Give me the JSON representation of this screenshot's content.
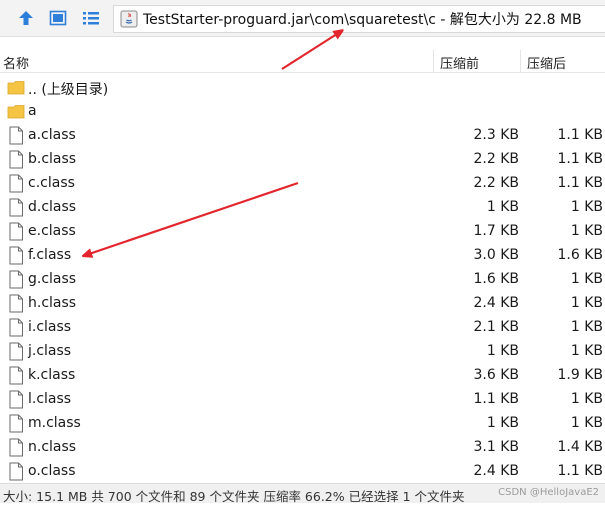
{
  "toolbar": {
    "icons": [
      "up-arrow-icon",
      "view-mode-icon",
      "list-mode-icon"
    ],
    "address": "TestStarter-proguard.jar\\com\\squaretest\\c - 解包大小为 22.8 MB"
  },
  "columns": {
    "name": "名称",
    "size": "压缩前",
    "packed": "压缩后"
  },
  "folders": [
    {
      "name": ".. (上级目录)"
    },
    {
      "name": "a"
    }
  ],
  "files": [
    {
      "name": "a.class",
      "size": "2.3 KB",
      "packed": "1.1 KB"
    },
    {
      "name": "b.class",
      "size": "2.2 KB",
      "packed": "1.1 KB"
    },
    {
      "name": "c.class",
      "size": "2.2 KB",
      "packed": "1.1 KB"
    },
    {
      "name": "d.class",
      "size": "1 KB",
      "packed": "1 KB"
    },
    {
      "name": "e.class",
      "size": "1.7 KB",
      "packed": "1 KB"
    },
    {
      "name": "f.class",
      "size": "3.0 KB",
      "packed": "1.6 KB"
    },
    {
      "name": "g.class",
      "size": "1.6 KB",
      "packed": "1 KB"
    },
    {
      "name": "h.class",
      "size": "2.4 KB",
      "packed": "1 KB"
    },
    {
      "name": "i.class",
      "size": "2.1 KB",
      "packed": "1 KB"
    },
    {
      "name": "j.class",
      "size": "1 KB",
      "packed": "1 KB"
    },
    {
      "name": "k.class",
      "size": "3.6 KB",
      "packed": "1.9 KB"
    },
    {
      "name": "l.class",
      "size": "1.1 KB",
      "packed": "1 KB"
    },
    {
      "name": "m.class",
      "size": "1 KB",
      "packed": "1 KB"
    },
    {
      "name": "n.class",
      "size": "3.1 KB",
      "packed": "1.4 KB"
    },
    {
      "name": "o.class",
      "size": "2.4 KB",
      "packed": "1.1 KB"
    }
  ],
  "status": {
    "text": "大小: 15.1 MB 共 700 个文件和 89 个文件夹 压缩率 66.2% 已经选择 1 个文件夹",
    "watermark": "CSDN @HelloJavaE2"
  },
  "colors": {
    "folder": "#f5c443",
    "arrow": "#e3262e",
    "accent": "#2d7fd9"
  }
}
